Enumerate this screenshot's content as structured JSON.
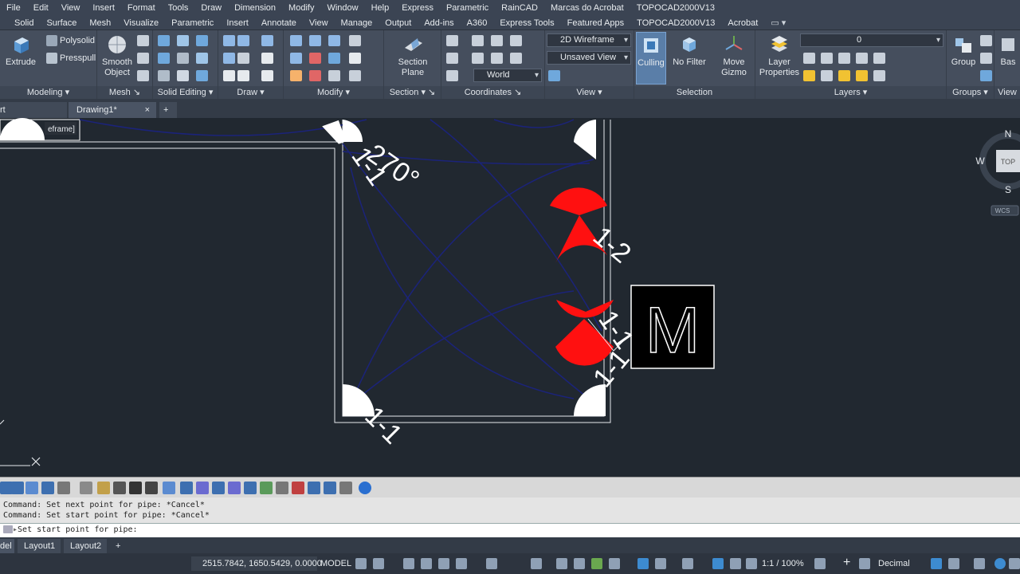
{
  "menu": [
    "File",
    "Edit",
    "View",
    "Insert",
    "Format",
    "Tools",
    "Draw",
    "Dimension",
    "Modify",
    "Window",
    "Help",
    "Express",
    "Parametric",
    "RainCAD",
    "Marcas do Acrobat",
    "TOPOCAD2000V13"
  ],
  "ribbon_tabs": [
    "Solid",
    "Surface",
    "Mesh",
    "Visualize",
    "Parametric",
    "Insert",
    "Annotate",
    "View",
    "Manage",
    "Output",
    "Add-ins",
    "A360",
    "Express Tools",
    "Featured Apps",
    "TOPOCAD2000V13",
    "Acrobat"
  ],
  "panels": {
    "modeling": {
      "title": "Modeling",
      "extrude": "Extrude",
      "polysolid": "Polysolid",
      "presspull": "Presspull"
    },
    "mesh": {
      "title": "Mesh",
      "smooth_l1": "Smooth",
      "smooth_l2": "Object"
    },
    "solid_editing": {
      "title": "Solid Editing"
    },
    "draw": {
      "title": "Draw"
    },
    "modify": {
      "title": "Modify"
    },
    "section": {
      "title": "Section",
      "plane_l1": "Section",
      "plane_l2": "Plane"
    },
    "coordinates": {
      "title": "Coordinates",
      "world": "World"
    },
    "view": {
      "title": "View",
      "visual_style": "2D Wireframe",
      "saved_view": "Unsaved View"
    },
    "selection": {
      "title": "Selection",
      "culling": "Culling",
      "nofilter": "No Filter",
      "gizmo_l1": "Move",
      "gizmo_l2": "Gizmo"
    },
    "layers": {
      "title": "Layers",
      "props_l1": "Layer",
      "props_l2": "Properties",
      "current_layer": "0"
    },
    "groups": {
      "title": "Groups",
      "group": "Group"
    },
    "view2": {
      "title": "View",
      "base": "Bas"
    }
  },
  "doc_tabs": {
    "start": "rt",
    "drawing": "Drawing1*",
    "close": "×",
    "add": "+"
  },
  "viewport": {
    "label_fragment": "eframe]",
    "annotations": {
      "angle": "270°",
      "top_left": "1-1",
      "right_upper": "1-2",
      "right_lower": "1-1",
      "right_bottom": "1-1",
      "bottom": "1-1"
    },
    "motor_symbol": "M",
    "viewcube": {
      "n": "N",
      "s": "S",
      "w": "W",
      "face": "TOP",
      "wcs": "WCS"
    }
  },
  "command_history": [
    "Command: Set next point for pipe: *Cancel*",
    "Command: Set start point for pipe: *Cancel*"
  ],
  "command_prompt": "Set start point for pipe:",
  "layout_tabs": [
    "del",
    "Layout1",
    "Layout2",
    "+"
  ],
  "status": {
    "coords": "2515.7842, 1650.5429, 0.0000",
    "model": "MODEL",
    "scale": "1:1 / 100%",
    "units": "Decimal"
  }
}
